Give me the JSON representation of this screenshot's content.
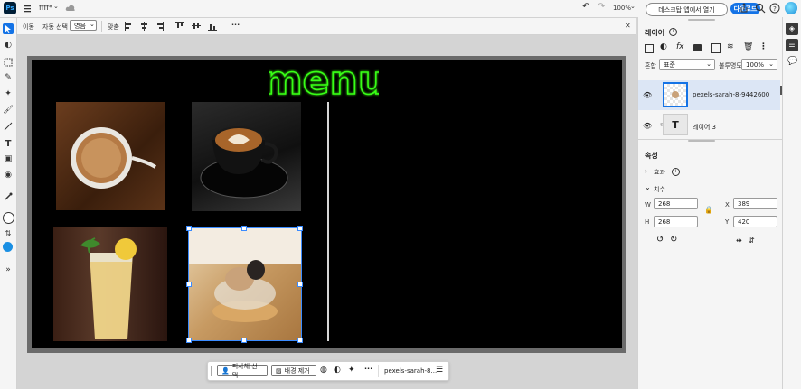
{
  "app": {
    "logo": "Ps",
    "doc_name": "ffff*",
    "zoom": "100%"
  },
  "topbar": {
    "open_desktop_label": "데스크탑 앱에서 열기",
    "download_label": "다운로드",
    "accent": "#1473e6"
  },
  "options": {
    "move_label": "이동",
    "auto_select_label": "자동 선택",
    "layer_select": "영음",
    "align_label": "맞춤",
    "more_label": "···",
    "close_label": "✕"
  },
  "canvas": {
    "menu_text": "menu",
    "neon_color": "#39ff14"
  },
  "layers_panel": {
    "title": "레이어",
    "blend_label": "혼합",
    "blend_value": "표준",
    "opacity_label": "불투명도",
    "opacity_value": "100%",
    "layers": [
      {
        "name": "pexels-sarah-8-9442600",
        "selected": true
      },
      {
        "name": "레이어 3",
        "selected": false
      }
    ]
  },
  "properties_panel": {
    "title": "속성",
    "effects_label": "효과",
    "dimensions_label": "치수",
    "w_label": "W",
    "w_value": "268",
    "h_label": "H",
    "h_value": "268",
    "x_label": "X",
    "x_value": "389",
    "y_label": "Y",
    "y_value": "420"
  },
  "context_bar": {
    "select_subject_label": "피사체 선택",
    "remove_bg_label": "배경 제거",
    "layer_name": "pexels-sarah-8...",
    "more_label": "···"
  }
}
